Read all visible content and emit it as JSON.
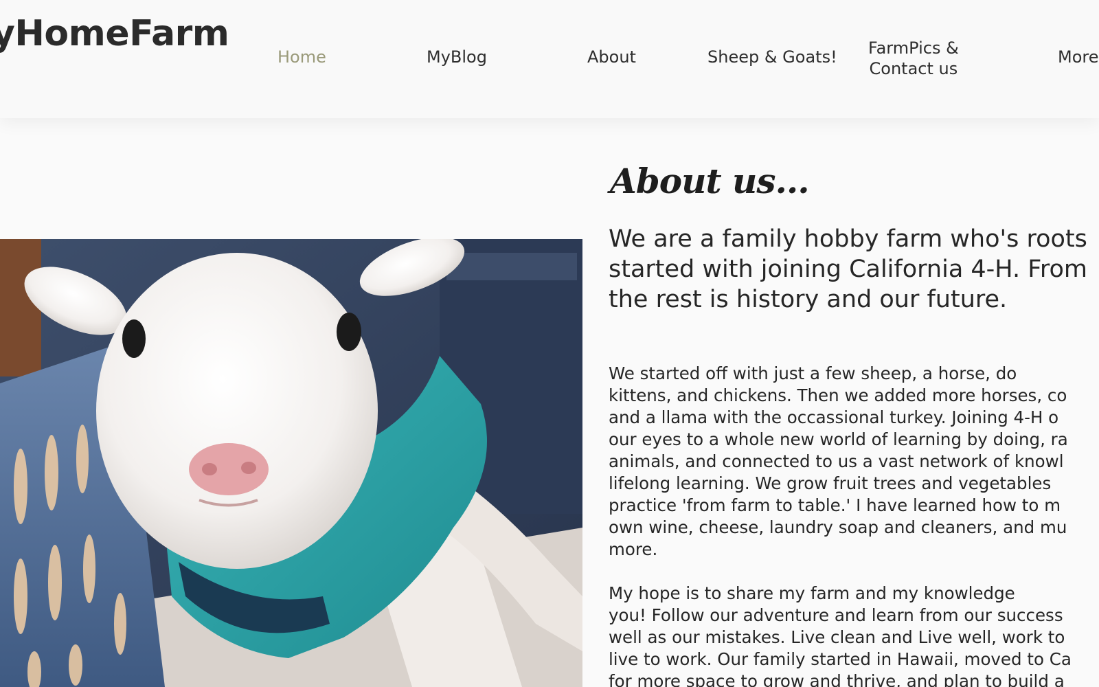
{
  "header": {
    "site_title": "yHomeFarm",
    "nav": [
      {
        "label": "Home",
        "active": true
      },
      {
        "label": "MyBlog",
        "active": false
      },
      {
        "label": "About",
        "active": false
      },
      {
        "label": "Sheep & Goats!",
        "active": false
      },
      {
        "label_line1": "FarmPics &",
        "label_line2": "Contact us",
        "active": false
      },
      {
        "label": "More",
        "active": false
      }
    ],
    "active_color": "#9a9a7a"
  },
  "main": {
    "about_title": "About us...",
    "intro": "We are a family hobby farm who's roots\nstarted with joining California 4-H. From\nthe rest is history and our future.",
    "paragraph1": "          We started off with just a few sheep, a horse, do\nkittens, and chickens. Then we added more horses, co\nand a llama with the occassional turkey. Joining 4-H o\nour eyes to a whole new world of learning by doing, ra\nanimals, and connected to us a vast network of knowl\nlifelong learning. We grow fruit trees and vegetables\npractice 'from farm to table.'  I have learned how to m\nown wine, cheese, laundry soap and cleaners, and mu\nmore.",
    "paragraph2": "          My hope is to share my farm and my knowledge\nyou! Follow our adventure and learn from our success\nwell as our mistakes. Live clean and Live well, work to\nlive to work. Our family started in Hawaii, moved to Ca\nfor more space to grow and thrive, and plan to build a"
  },
  "photo": {
    "subject_icon": "lamb-in-sweater",
    "sweater_color": "#2aa3a8",
    "basket_color": "#4f6f9a"
  }
}
